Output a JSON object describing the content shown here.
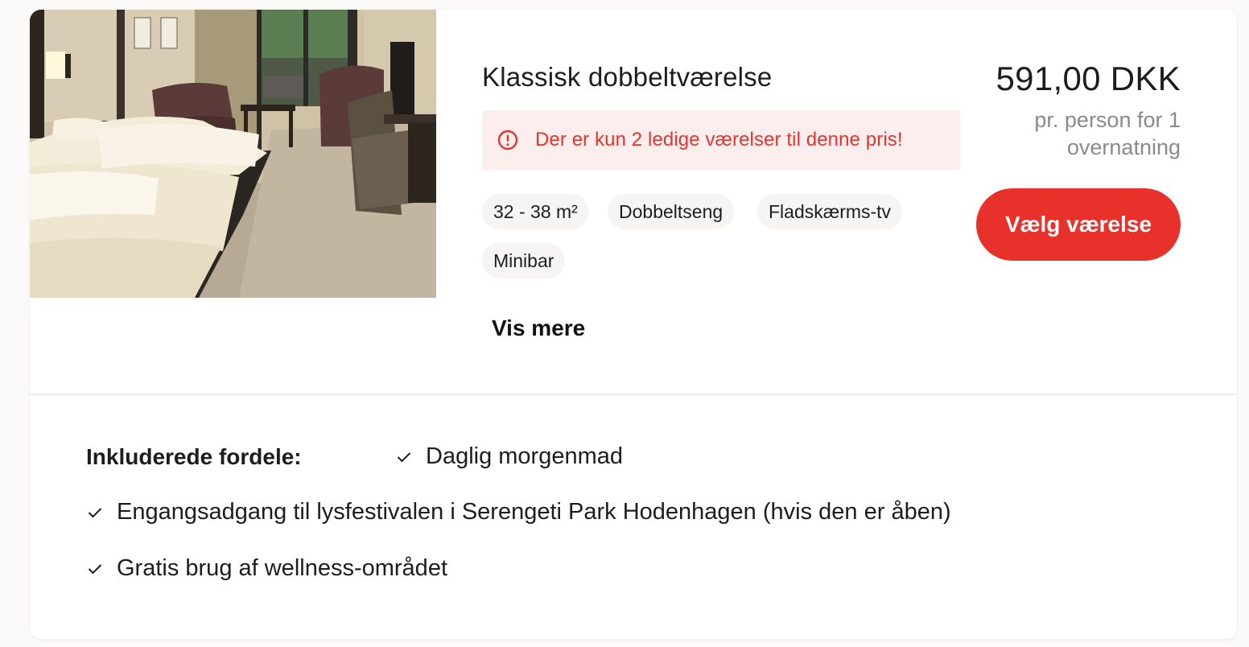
{
  "room": {
    "title": "Klassisk dobbeltværelse",
    "image_alt": "Hotelværelse med dobbeltseng",
    "alert": "Der er kun 2 ledige værelser til denne pris!",
    "tags": [
      "32 - 38 m²",
      "Dobbeltseng",
      "Fladskærms-tv",
      "Minibar"
    ],
    "more_link": "Vis mere"
  },
  "pricing": {
    "price": "591,00 DKK",
    "note": "pr. person for 1 overnatning",
    "button_label": "Vælg værelse"
  },
  "benefits": {
    "label": "Inkluderede fordele:",
    "items": [
      "Daglig morgenmad",
      "Engangsadgang til lysfestivalen i Serengeti Park Hodenhagen (hvis den er åben)",
      "Gratis brug af wellness-området"
    ]
  },
  "colors": {
    "accent": "#e8312b",
    "alert_background": "#fdeeee",
    "alert_text": "#e3352f",
    "muted_text": "#8a8a8a"
  },
  "icons": {
    "alert": "exclamation-circle-icon",
    "benefit": "check-icon"
  }
}
